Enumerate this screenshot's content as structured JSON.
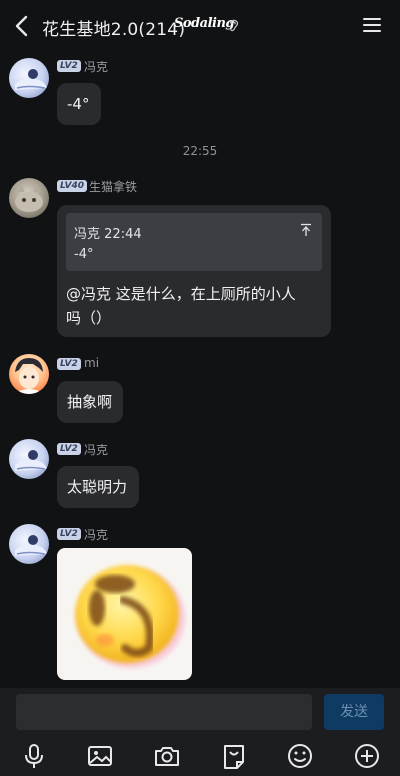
{
  "header": {
    "title": "花生基地2.0(214)",
    "logo_text": "Sodaling"
  },
  "messages": [
    {
      "sender": "冯克",
      "level": "LV2",
      "text": "-4°"
    },
    {
      "timestamp": "22:55"
    },
    {
      "sender": "生猫拿铁",
      "level": "LV40",
      "quote": {
        "author": "冯克",
        "time": "22:44",
        "text": "-4°"
      },
      "text_line1": "@冯克 这是什么，在上厕所的小人",
      "text_line2": "吗（）"
    },
    {
      "sender": "mi",
      "level": "LV2",
      "text": "抽象啊"
    },
    {
      "sender": "冯克",
      "level": "LV2",
      "text": "太聪明力"
    },
    {
      "sender": "冯克",
      "level": "LV2",
      "sticker": "smiley-face-sticker"
    }
  ],
  "input": {
    "value": "",
    "send_label": "发送"
  },
  "toolbar": {
    "icons": [
      "microphone-icon",
      "image-icon",
      "camera-icon",
      "sticker-bag-icon",
      "emoji-icon",
      "plus-icon"
    ]
  },
  "colors": {
    "background": "#111214",
    "bubble": "#2a2b2f",
    "send_button": "#0f3b63",
    "level_badge": "#c9d2e6"
  }
}
